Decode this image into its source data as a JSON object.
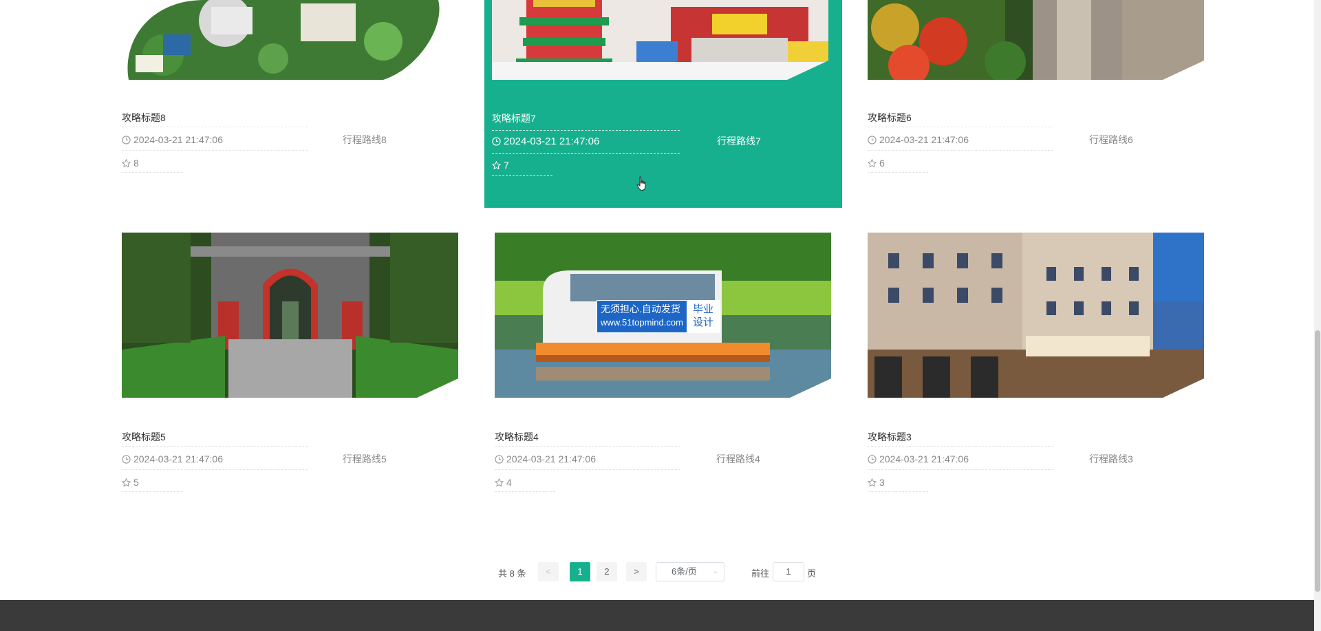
{
  "cards": [
    {
      "title": "攻略标题8",
      "time": "2024-03-21 21:47:06",
      "route": "行程路线8",
      "favorites": "8"
    },
    {
      "title": "攻略标题7",
      "time": "2024-03-21 21:47:06",
      "route": "行程路线7",
      "favorites": "7"
    },
    {
      "title": "攻略标题6",
      "time": "2024-03-21 21:47:06",
      "route": "行程路线6",
      "favorites": "6"
    },
    {
      "title": "攻略标题5",
      "time": "2024-03-21 21:47:06",
      "route": "行程路线5",
      "favorites": "5"
    },
    {
      "title": "攻略标题4",
      "time": "2024-03-21 21:47:06",
      "route": "行程路线4",
      "favorites": "4"
    },
    {
      "title": "攻略标题3",
      "time": "2024-03-21 21:47:06",
      "route": "行程路线3",
      "favorites": "3"
    }
  ],
  "pagination": {
    "total": "共 8 条",
    "prev": "<",
    "pages": [
      "1",
      "2"
    ],
    "next": ">",
    "page_size": "6条/页",
    "goto_label": "前往",
    "goto_value": "1",
    "goto_suffix": "页"
  },
  "watermark": {
    "left_line1": "无须担心.自动发货",
    "left_line2": "www.51topmind.com",
    "right_line1": "毕业",
    "right_line2": "设计"
  },
  "colors": {
    "accent": "#17b08e",
    "footer": "#3a3a3a"
  }
}
